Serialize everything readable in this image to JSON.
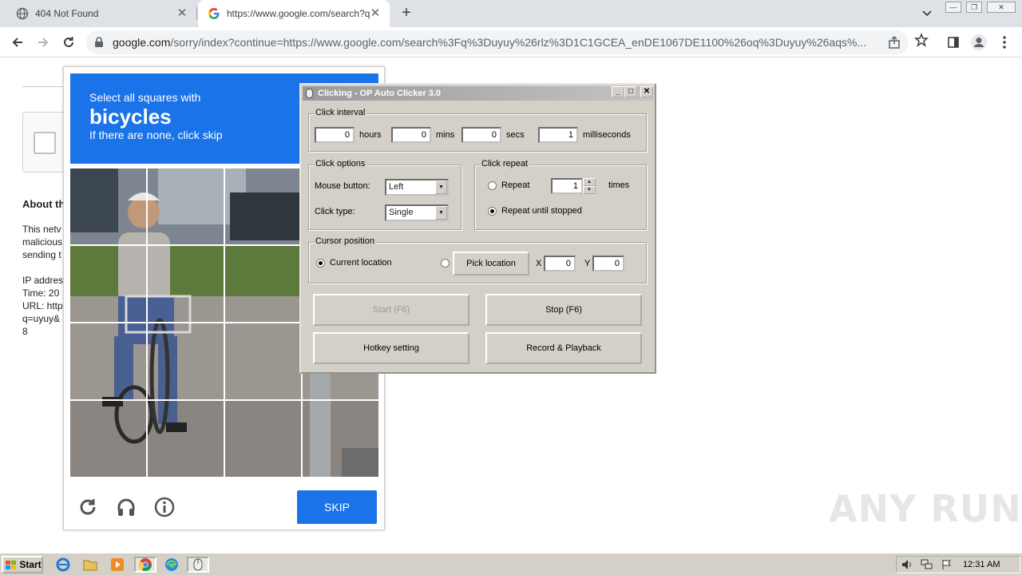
{
  "browser": {
    "tabs": [
      {
        "title": "404 Not Found",
        "icon": "globe-icon"
      },
      {
        "title": "https://www.google.com/search?q=",
        "icon": "google-icon"
      }
    ],
    "url_host": "google.com",
    "url_rest": "/sorry/index?continue=https://www.google.com/search%3Fq%3Duyuy%26rlz%3D1C1GCEA_enDE1067DE1100%26oq%3Duyuy%26aqs%..."
  },
  "page": {
    "about_heading": "About th",
    "lines": [
      "This netv",
      "malicious",
      "sending t",
      "",
      "IP addres",
      "Time: 20",
      "URL: http",
      "q=uyuy&",
      "8"
    ]
  },
  "recaptcha": {
    "instruction": "Select all squares with",
    "target": "bicycles",
    "hint": "If there are none, click skip",
    "skip_label": "SKIP",
    "icons": [
      "reload-icon",
      "headphones-icon",
      "info-icon"
    ]
  },
  "clicker": {
    "title": "Clicking - OP Auto Clicker 3.0",
    "interval": {
      "legend": "Click interval",
      "hours_value": "0",
      "hours_label": "hours",
      "mins_value": "0",
      "mins_label": "mins",
      "secs_value": "0",
      "secs_label": "secs",
      "ms_value": "1",
      "ms_label": "milliseconds"
    },
    "options": {
      "legend": "Click options",
      "mouse_label": "Mouse button:",
      "mouse_value": "Left",
      "type_label": "Click type:",
      "type_value": "Single"
    },
    "repeat": {
      "legend": "Click repeat",
      "repeat_label": "Repeat",
      "repeat_value": "1",
      "times_label": "times",
      "until_label": "Repeat until stopped",
      "selected": "until_stopped"
    },
    "cursor": {
      "legend": "Cursor position",
      "current_label": "Current location",
      "pick_label": "Pick location",
      "x_label": "X",
      "x_value": "0",
      "y_label": "Y",
      "y_value": "0",
      "selected": "current"
    },
    "buttons": {
      "start": "Start (F6)",
      "stop": "Stop (F6)",
      "hotkey": "Hotkey setting",
      "record": "Record & Playback"
    }
  },
  "watermark": "ANY RUN",
  "taskbar": {
    "start_label": "Start",
    "clock": "12:31 AM"
  },
  "colors": {
    "google_blue": "#1a73e8",
    "win_face": "#d4d0c8"
  }
}
